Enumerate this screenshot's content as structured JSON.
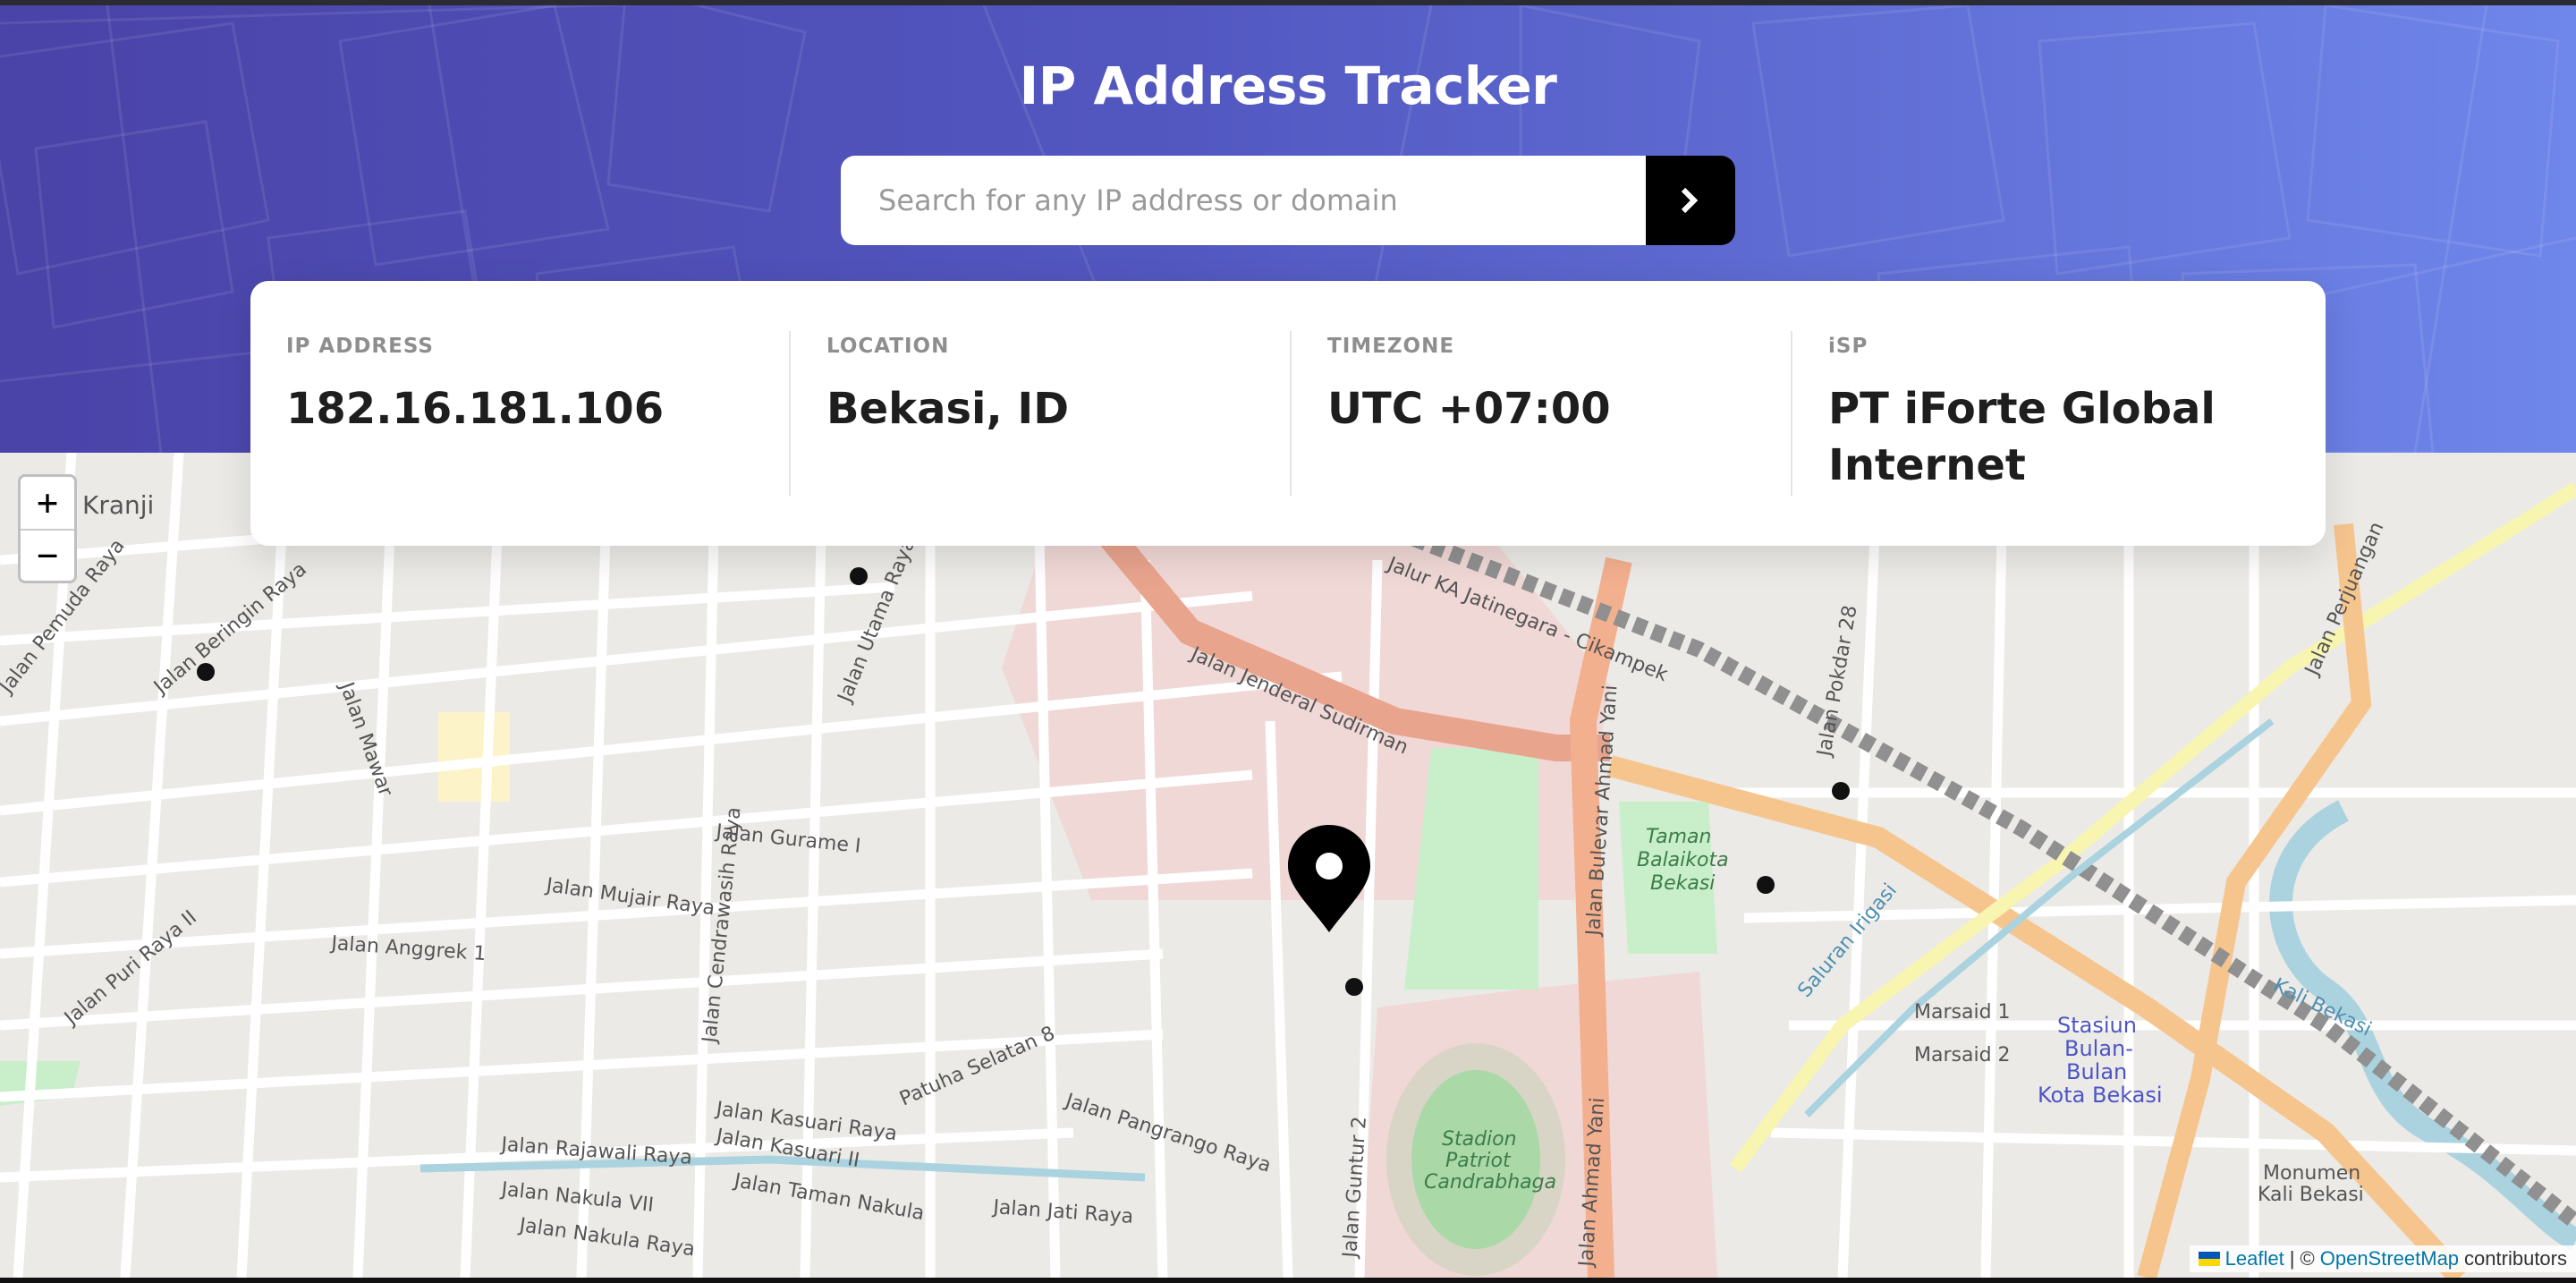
{
  "header": {
    "title": "IP Address Tracker",
    "search_placeholder": "Search for any IP address or domain",
    "submit_icon": "chevron-right-icon"
  },
  "info": [
    {
      "label": "IP ADDRESS",
      "value": "182.16.181.106"
    },
    {
      "label": "LOCATION",
      "value": "Bekasi, ID"
    },
    {
      "label": "TIMEZONE",
      "value": "UTC +07:00"
    },
    {
      "label": "iSP",
      "value": "PT iForte Global Internet"
    }
  ],
  "map": {
    "zoom_in": "+",
    "zoom_out": "−",
    "marker_icon": "location-pin-icon",
    "labels": {
      "kranji": "Kranji",
      "jalan_jenderal_sudirman": "Jalan Jenderal Sudirman",
      "jalan_bulevar": "Jalan Bulevar Ahmad Yani",
      "jalan_ahmad_yani": "Jalan Ahmad Yani",
      "jalan_gurame": "Jalan Gurame I",
      "jalan_anggrek": "Jalan Anggrek 1",
      "jalan_mujair": "Jalan Mujair Raya",
      "jalan_kasuari": "Jalan Kasuari Raya",
      "jalan_kasuari2": "Jalan Kasuari II",
      "jalan_taman_nakula": "Jalan Taman Nakula",
      "jalan_nakula_raya": "Jalan Nakula Raya",
      "jalan_nakula_vii": "Jalan Nakula VII",
      "jalan_rajawali": "Jalan Rajawali Raya",
      "jalan_jati": "Jalan Jati Raya",
      "jalan_pangrango": "Jalan Pangrango Raya",
      "patuha": "Patuha Selatan 8",
      "jalan_perjuangan": "Jalan Perjuangan",
      "jalan_pokdar": "Jalan Pokdar 28",
      "jalur_ka": "Jalur KA Jatinegara - Cikampek",
      "saluran": "Saluran Irigasi",
      "kali_bekasi": "Kali Bekasi",
      "marsaid1": "Marsaid 1",
      "marsaid2": "Marsaid 2",
      "taman1": "Taman",
      "taman2": "Balaikota",
      "taman3": "Bekasi",
      "stadion1": "Stadion",
      "stadion2": "Patriot",
      "stadion3": "Candrabhaga",
      "stasiun1": "Stasiun",
      "stasiun2": "Bulan-",
      "stasiun3": "Bulan",
      "stasiun4": "Kota Bekasi",
      "monumen1": "Monumen",
      "monumen2": "Kali Bekasi",
      "jalan_guntur": "Jalan Guntur 2",
      "jalan_puri": "Jalan Puri Raya II",
      "jalan_cendrawasih": "Jalan Cendrawasih Raya",
      "jalan_pemuda": "Jalan Pemuda Raya",
      "jalan_utama": "Jalan Utama Raya",
      "jalan_mawar": "Jalan Mawar",
      "jalan_beringin": "Jalan Beringin Raya"
    },
    "attribution": {
      "leaflet": "Leaflet",
      "separator": "| ©",
      "osm": "OpenStreetMap",
      "contributors": "contributors"
    }
  }
}
